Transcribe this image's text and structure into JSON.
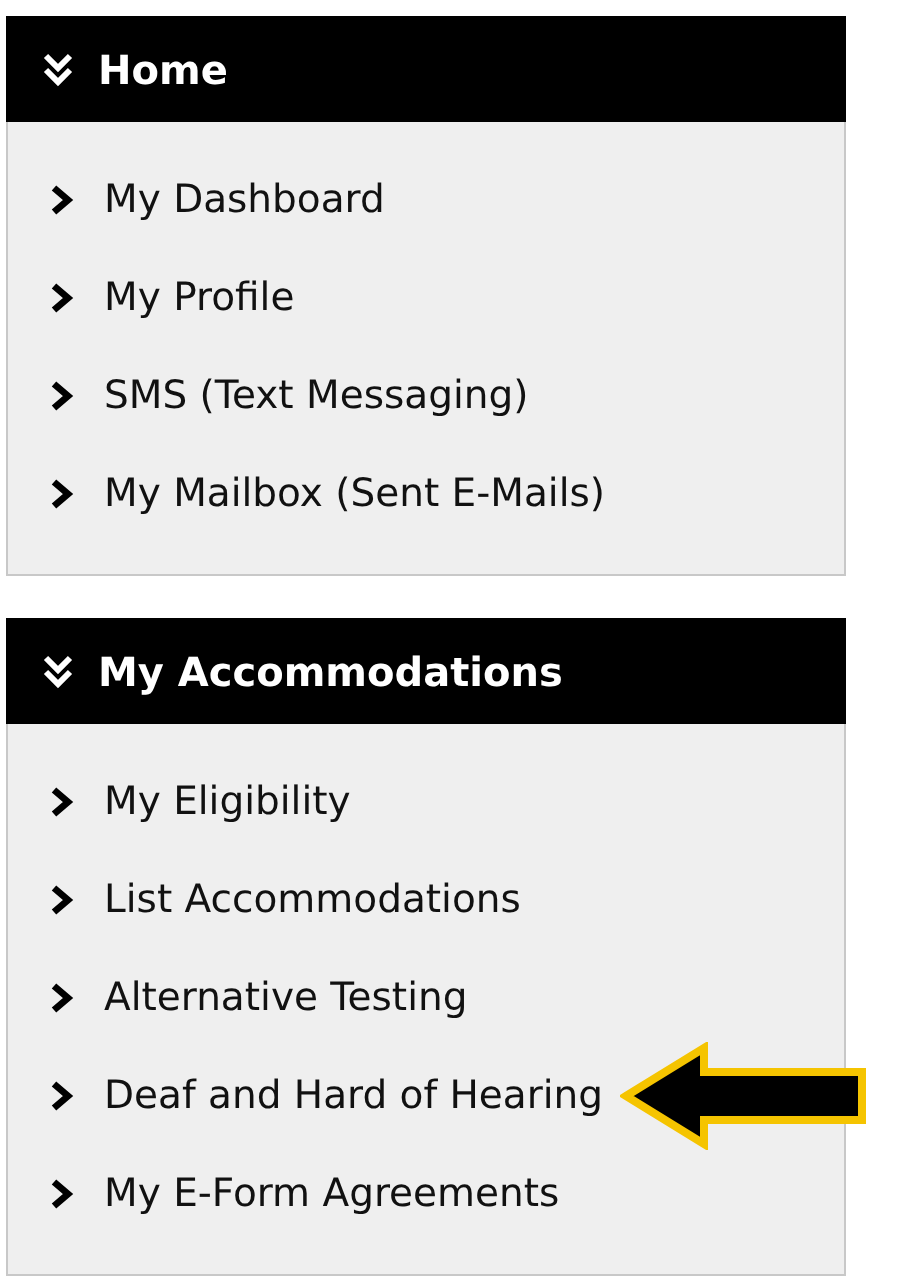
{
  "sections": [
    {
      "title": "Home",
      "items": [
        {
          "label": "My Dashboard",
          "pointed": false
        },
        {
          "label": "My Profile",
          "pointed": false
        },
        {
          "label": "SMS (Text Messaging)",
          "pointed": false
        },
        {
          "label": "My Mailbox (Sent E-Mails)",
          "pointed": false
        }
      ]
    },
    {
      "title": "My Accommodations",
      "items": [
        {
          "label": "My Eligibility",
          "pointed": false
        },
        {
          "label": "List Accommodations",
          "pointed": false
        },
        {
          "label": "Alternative Testing",
          "pointed": false
        },
        {
          "label": "Deaf and Hard of Hearing",
          "pointed": true
        },
        {
          "label": "My E-Form Agreements",
          "pointed": false
        }
      ]
    }
  ]
}
